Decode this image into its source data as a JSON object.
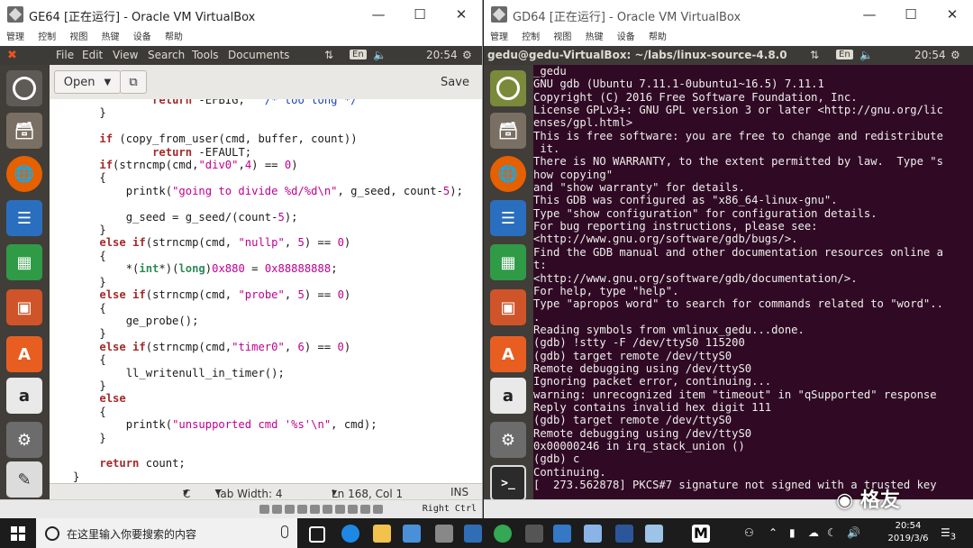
{
  "left_window": {
    "title": "GE64 [正在运行] - Oracle VM VirtualBox",
    "menu": [
      "管理",
      "控制",
      "视图",
      "热键",
      "设备",
      "帮助"
    ],
    "panel": {
      "menus": [
        "File",
        "Edit",
        "View",
        "Search",
        "Tools",
        "Documents"
      ],
      "lang": "En",
      "time": "20:54"
    },
    "gedit": {
      "open_label": "Open",
      "save_label": "Save",
      "status": {
        "lang": "C",
        "tab_width": "Tab Width: 4",
        "position": "Ln 168, Col 1",
        "mode": "INS"
      }
    },
    "host_key": "Right Ctrl"
  },
  "right_window": {
    "title": "GD64 [正在运行] - Oracle VM VirtualBox",
    "menu": [
      "管理",
      "控制",
      "视图",
      "热键",
      "设备",
      "帮助"
    ],
    "panel": {
      "terminal_title": "gedu@gedu-VirtualBox: ~/labs/linux-source-4.8.0",
      "lang": "En",
      "time": "20:54"
    },
    "terminal_lines": [
      "_gedu",
      "GNU gdb (Ubuntu 7.11.1-0ubuntu1~16.5) 7.11.1",
      "Copyright (C) 2016 Free Software Foundation, Inc.",
      "License GPLv3+: GNU GPL version 3 or later <http://gnu.org/lic",
      "enses/gpl.html>",
      "This is free software: you are free to change and redistribute",
      " it.",
      "There is NO WARRANTY, to the extent permitted by law.  Type \"s",
      "how copying\"",
      "and \"show warranty\" for details.",
      "This GDB was configured as \"x86_64-linux-gnu\".",
      "Type \"show configuration\" for configuration details.",
      "For bug reporting instructions, please see:",
      "<http://www.gnu.org/software/gdb/bugs/>.",
      "Find the GDB manual and other documentation resources online a",
      "t:",
      "<http://www.gnu.org/software/gdb/documentation/>.",
      "For help, type \"help\".",
      "Type \"apropos word\" to search for commands related to \"word\"..",
      ".",
      "Reading symbols from vmlinux_gedu...done.",
      "(gdb) !stty -F /dev/ttyS0 115200",
      "(gdb) target remote /dev/ttyS0",
      "Remote debugging using /dev/ttyS0",
      "Ignoring packet error, continuing...",
      "warning: unrecognized item \"timeout\" in \"qSupported\" response",
      "Reply contains invalid hex digit 111",
      "(gdb) target remote /dev/ttyS0",
      "Remote debugging using /dev/ttyS0",
      "0x00000246 in irq_stack_union ()",
      "(gdb) c",
      "Continuing.",
      "[  273.562878] PKCS#7 signature not signed with a trusted key"
    ]
  },
  "taskbar": {
    "search_placeholder": "在这里输入你要搜索的内容",
    "time": "20:54",
    "date": "2019/3/6",
    "notifications": "3"
  },
  "watermark": "格友"
}
